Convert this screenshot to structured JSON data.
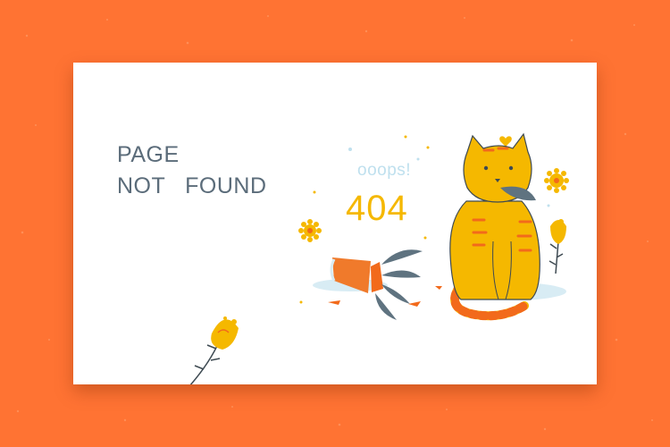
{
  "page": {
    "headline_line1": "PAGE",
    "headline_line2": "NOT   FOUND",
    "exclamation": "ooops!",
    "error_code": "404"
  },
  "colors": {
    "background": "#FF7333",
    "card": "#FFFFFF",
    "headline": "#5B6C7A",
    "code": "#F5B800",
    "exclamation": "#BFE0EE"
  },
  "icons": [
    "cat-illustration",
    "flower-pot-icon",
    "flower-icon",
    "sun-flower-icon",
    "heart-icon"
  ]
}
